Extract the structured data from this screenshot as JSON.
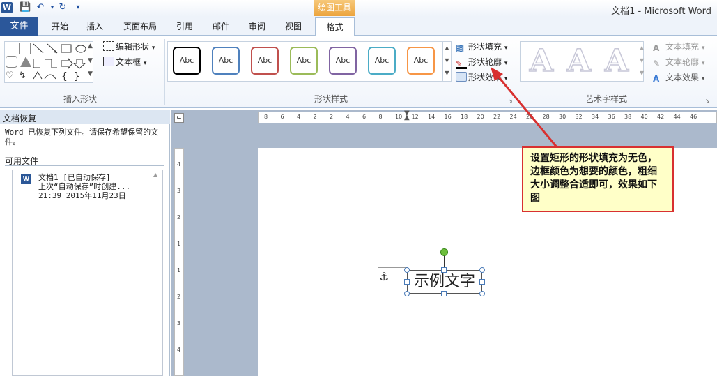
{
  "window": {
    "title": "文档1 - Microsoft Word",
    "context_tab": "绘图工具"
  },
  "tabs": {
    "file": "文件",
    "home": "开始",
    "insert": "插入",
    "layout": "页面布局",
    "refs": "引用",
    "mail": "邮件",
    "review": "审阅",
    "view": "视图",
    "format": "格式"
  },
  "ribbon": {
    "edit_shape": "编辑形状",
    "text_box": "文本框",
    "insert_shapes_label": "插入形状",
    "style_sample": "Abc",
    "shape_styles_label": "形状样式",
    "shape_fill": "形状填充",
    "shape_outline": "形状轮廓",
    "shape_effects": "形状效果",
    "wordart_sample": "A",
    "text_fill": "文本填充",
    "text_outline": "文本轮廓",
    "text_effects": "文本效果",
    "wordart_label": "艺术字样式",
    "style_colors": [
      "#000000",
      "#4f81bd",
      "#c0504d",
      "#9bbb59",
      "#8064a2",
      "#4bacc6",
      "#f79646"
    ]
  },
  "recovery": {
    "title": "文档恢复",
    "message": "Word 已恢复下列文件。请保存希望保留的文件。",
    "available": "可用文件",
    "file_name": "文档1  [已自动保存]",
    "file_desc": "上次“自动保存”时创建...",
    "file_time": "21:39 2015年11月23日"
  },
  "ruler": {
    "h_ticks": [
      "8",
      "6",
      "4",
      "2",
      "2",
      "4",
      "6",
      "8",
      "10",
      "12",
      "14",
      "16",
      "18",
      "20",
      "22",
      "24",
      "26",
      "28",
      "30",
      "32",
      "34",
      "36",
      "38",
      "40",
      "42",
      "44",
      "46"
    ],
    "v_ticks": [
      "4",
      "3",
      "2",
      "1",
      "1",
      "2",
      "3",
      "4"
    ]
  },
  "annotation": "设置矩形的形状填充为无色，边框颜色为想要的颜色，粗细大小调整合适即可，效果如下图",
  "document": {
    "sample_text": "示例文字"
  },
  "colors": {
    "file_tab": "#2b579a",
    "context_tab": "#eca43d",
    "callout_border": "#d83030",
    "callout_bg": "#ffffc8",
    "arrow": "#d83030",
    "rotate_handle": "#6dbe3c"
  }
}
